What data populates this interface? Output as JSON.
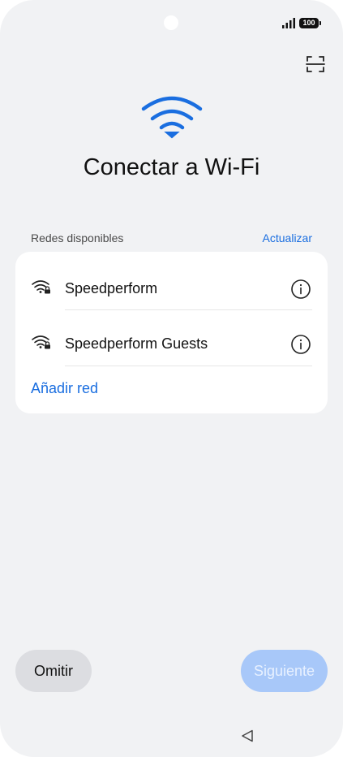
{
  "status_bar": {
    "battery": "100"
  },
  "title": "Conectar a Wi-Fi",
  "section": {
    "label": "Redes disponibles",
    "refresh": "Actualizar"
  },
  "networks": [
    {
      "name": "Speedperform",
      "secured": true
    },
    {
      "name": "Speedperform Guests",
      "secured": true
    }
  ],
  "add_network": "Añadir red",
  "buttons": {
    "skip": "Omitir",
    "next": "Siguiente"
  },
  "colors": {
    "accent": "#1a6ee0",
    "background": "#f1f2f4",
    "next_disabled": "#a8c8f9"
  },
  "icons": {
    "scan": "qr-scan-icon",
    "hero": "wifi-icon",
    "network": "wifi-locked-icon",
    "info": "info-icon",
    "nav_back": "back-triangle-icon"
  }
}
